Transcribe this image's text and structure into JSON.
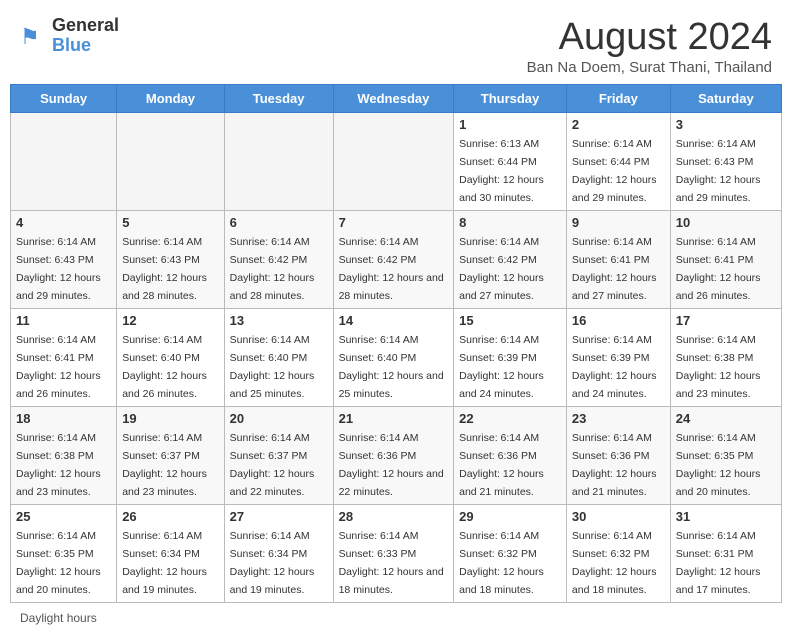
{
  "logo": {
    "general": "General",
    "blue": "Blue"
  },
  "header": {
    "month": "August 2024",
    "location": "Ban Na Doem, Surat Thani, Thailand"
  },
  "days_of_week": [
    "Sunday",
    "Monday",
    "Tuesday",
    "Wednesday",
    "Thursday",
    "Friday",
    "Saturday"
  ],
  "footer": {
    "label": "Daylight hours"
  },
  "weeks": [
    [
      {
        "day": "",
        "empty": true
      },
      {
        "day": "",
        "empty": true
      },
      {
        "day": "",
        "empty": true
      },
      {
        "day": "",
        "empty": true
      },
      {
        "day": "1",
        "rise": "6:13 AM",
        "set": "6:44 PM",
        "hours": "12 hours and 30 minutes."
      },
      {
        "day": "2",
        "rise": "6:14 AM",
        "set": "6:44 PM",
        "hours": "12 hours and 29 minutes."
      },
      {
        "day": "3",
        "rise": "6:14 AM",
        "set": "6:43 PM",
        "hours": "12 hours and 29 minutes."
      }
    ],
    [
      {
        "day": "4",
        "rise": "6:14 AM",
        "set": "6:43 PM",
        "hours": "12 hours and 29 minutes."
      },
      {
        "day": "5",
        "rise": "6:14 AM",
        "set": "6:43 PM",
        "hours": "12 hours and 28 minutes."
      },
      {
        "day": "6",
        "rise": "6:14 AM",
        "set": "6:42 PM",
        "hours": "12 hours and 28 minutes."
      },
      {
        "day": "7",
        "rise": "6:14 AM",
        "set": "6:42 PM",
        "hours": "12 hours and 28 minutes."
      },
      {
        "day": "8",
        "rise": "6:14 AM",
        "set": "6:42 PM",
        "hours": "12 hours and 27 minutes."
      },
      {
        "day": "9",
        "rise": "6:14 AM",
        "set": "6:41 PM",
        "hours": "12 hours and 27 minutes."
      },
      {
        "day": "10",
        "rise": "6:14 AM",
        "set": "6:41 PM",
        "hours": "12 hours and 26 minutes."
      }
    ],
    [
      {
        "day": "11",
        "rise": "6:14 AM",
        "set": "6:41 PM",
        "hours": "12 hours and 26 minutes."
      },
      {
        "day": "12",
        "rise": "6:14 AM",
        "set": "6:40 PM",
        "hours": "12 hours and 26 minutes."
      },
      {
        "day": "13",
        "rise": "6:14 AM",
        "set": "6:40 PM",
        "hours": "12 hours and 25 minutes."
      },
      {
        "day": "14",
        "rise": "6:14 AM",
        "set": "6:40 PM",
        "hours": "12 hours and 25 minutes."
      },
      {
        "day": "15",
        "rise": "6:14 AM",
        "set": "6:39 PM",
        "hours": "12 hours and 24 minutes."
      },
      {
        "day": "16",
        "rise": "6:14 AM",
        "set": "6:39 PM",
        "hours": "12 hours and 24 minutes."
      },
      {
        "day": "17",
        "rise": "6:14 AM",
        "set": "6:38 PM",
        "hours": "12 hours and 23 minutes."
      }
    ],
    [
      {
        "day": "18",
        "rise": "6:14 AM",
        "set": "6:38 PM",
        "hours": "12 hours and 23 minutes."
      },
      {
        "day": "19",
        "rise": "6:14 AM",
        "set": "6:37 PM",
        "hours": "12 hours and 23 minutes."
      },
      {
        "day": "20",
        "rise": "6:14 AM",
        "set": "6:37 PM",
        "hours": "12 hours and 22 minutes."
      },
      {
        "day": "21",
        "rise": "6:14 AM",
        "set": "6:36 PM",
        "hours": "12 hours and 22 minutes."
      },
      {
        "day": "22",
        "rise": "6:14 AM",
        "set": "6:36 PM",
        "hours": "12 hours and 21 minutes."
      },
      {
        "day": "23",
        "rise": "6:14 AM",
        "set": "6:36 PM",
        "hours": "12 hours and 21 minutes."
      },
      {
        "day": "24",
        "rise": "6:14 AM",
        "set": "6:35 PM",
        "hours": "12 hours and 20 minutes."
      }
    ],
    [
      {
        "day": "25",
        "rise": "6:14 AM",
        "set": "6:35 PM",
        "hours": "12 hours and 20 minutes."
      },
      {
        "day": "26",
        "rise": "6:14 AM",
        "set": "6:34 PM",
        "hours": "12 hours and 19 minutes."
      },
      {
        "day": "27",
        "rise": "6:14 AM",
        "set": "6:34 PM",
        "hours": "12 hours and 19 minutes."
      },
      {
        "day": "28",
        "rise": "6:14 AM",
        "set": "6:33 PM",
        "hours": "12 hours and 18 minutes."
      },
      {
        "day": "29",
        "rise": "6:14 AM",
        "set": "6:32 PM",
        "hours": "12 hours and 18 minutes."
      },
      {
        "day": "30",
        "rise": "6:14 AM",
        "set": "6:32 PM",
        "hours": "12 hours and 18 minutes."
      },
      {
        "day": "31",
        "rise": "6:14 AM",
        "set": "6:31 PM",
        "hours": "12 hours and 17 minutes."
      }
    ]
  ]
}
